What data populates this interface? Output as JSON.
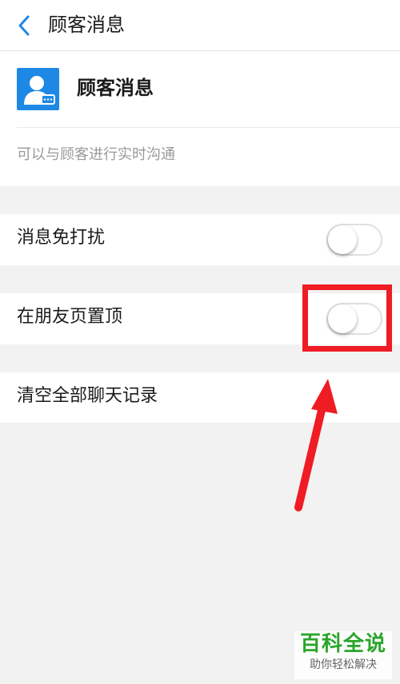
{
  "header": {
    "title": "顾客消息",
    "back_icon": "chevron-left-icon"
  },
  "profile": {
    "name": "顾客消息",
    "description": "可以与顾客进行实时沟通",
    "avatar_color": "#1e88e5"
  },
  "settings": {
    "mute": {
      "label": "消息免打扰",
      "enabled": false
    },
    "pin": {
      "label": "在朋友页置顶",
      "enabled": false
    },
    "clear": {
      "label": "清空全部聊天记录"
    }
  },
  "annotation": {
    "color": "#ef1c24"
  },
  "watermark": {
    "main": "百科全说",
    "sub": "助你轻松解决"
  }
}
